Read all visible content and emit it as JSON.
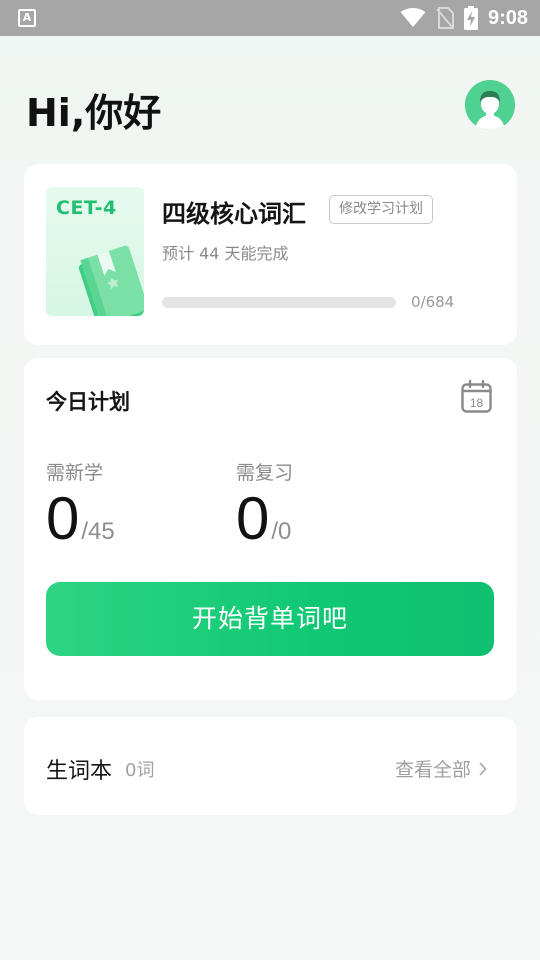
{
  "status_bar": {
    "app_icon": "A",
    "time": "9:08",
    "icons": [
      "wifi-icon",
      "no-sim-icon",
      "battery-charging-icon"
    ]
  },
  "header": {
    "greeting": "Hi,你好",
    "avatar_icon": "user-avatar-icon"
  },
  "book": {
    "cover_label": "CET-4",
    "title": "四级核心词汇",
    "edit_plan_label": "修改学习计划",
    "estimate": "预计 44 天能完成",
    "progress_fraction": 0.0,
    "progress_text": "0/684"
  },
  "plan": {
    "title": "今日计划",
    "calendar_day": "18",
    "new_label": "需新学",
    "new_value": "0",
    "new_total": "/45",
    "review_label": "需复习",
    "review_value": "0",
    "review_total": "/0",
    "start_button": "开始背单词吧"
  },
  "vocab": {
    "title": "生词本",
    "count": "0词",
    "view_all": "查看全部"
  },
  "colors": {
    "accent": "#1fc973",
    "status_bar": "#a6a6a6"
  }
}
